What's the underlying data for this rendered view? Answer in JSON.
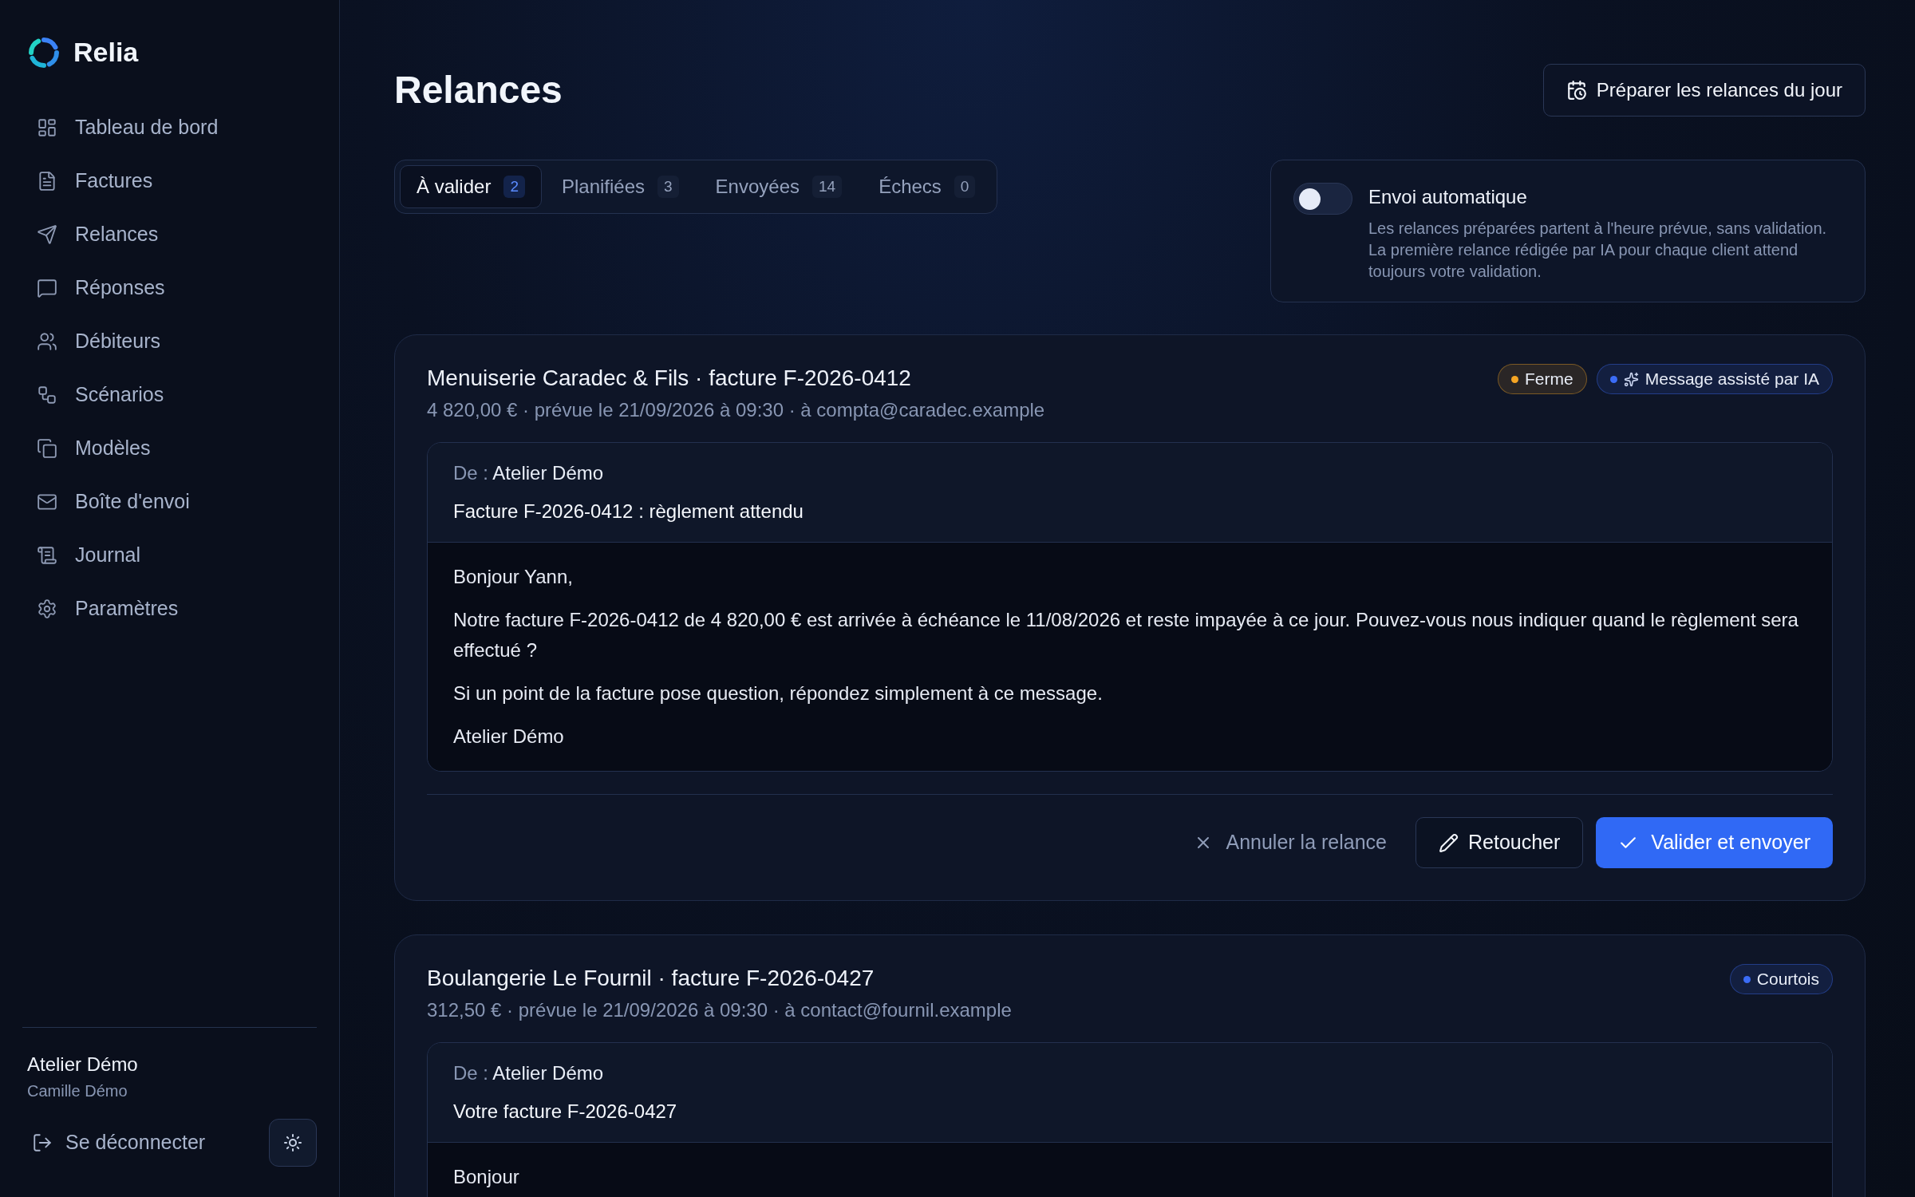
{
  "sidebar": {
    "brand": "Relia",
    "nav": [
      {
        "label": "Tableau de bord"
      },
      {
        "label": "Factures"
      },
      {
        "label": "Relances"
      },
      {
        "label": "Réponses"
      },
      {
        "label": "Débiteurs"
      },
      {
        "label": "Scénarios"
      },
      {
        "label": "Modèles"
      },
      {
        "label": "Boîte d'envoi"
      },
      {
        "label": "Journal"
      },
      {
        "label": "Paramètres"
      }
    ],
    "account": {
      "company": "Atelier Démo",
      "user": "Camille Démo"
    },
    "logout": "Se déconnecter"
  },
  "page": {
    "title": "Relances",
    "action": "Préparer les relances du jour"
  },
  "tabs": [
    {
      "label": "À valider",
      "count": "2",
      "selected": true
    },
    {
      "label": "Planifiées",
      "count": "3",
      "selected": false
    },
    {
      "label": "Envoyées",
      "count": "14",
      "selected": false
    },
    {
      "label": "Échecs",
      "count": "0",
      "selected": false
    }
  ],
  "auto_send": {
    "title": "Envoi automatique",
    "description": "Les relances préparées partent à l'heure prévue, sans validation. La première relance rédigée par IA pour chaque client attend toujours votre validation.",
    "on": false
  },
  "reminders": [
    {
      "title": "Menuiserie Caradec & Fils · facture F-2026-0412",
      "meta": "4 820,00 € · prévue le 21/09/2026 à 09:30 · à compta@caradec.example",
      "badges": [
        {
          "label": "Ferme",
          "color": "#f5a524",
          "kind": "tone"
        },
        {
          "label": "Message assisté par IA",
          "color": "#3b6cf6",
          "kind": "ai"
        }
      ],
      "from_label": "De :",
      "from": "Atelier Démo",
      "subject": "Facture F-2026-0412 : règlement attendu",
      "body": [
        "Bonjour Yann,",
        "Notre facture F-2026-0412 de 4 820,00 € est arrivée à échéance le 11/08/2026 et reste impayée à ce jour. Pouvez-vous nous indiquer quand le règlement sera effectué ?",
        "Si un point de la facture pose question, répondez simplement à ce message.",
        "Atelier Démo"
      ],
      "actions": {
        "cancel": "Annuler la relance",
        "edit": "Retoucher",
        "send": "Valider et envoyer"
      }
    },
    {
      "title": "Boulangerie Le Fournil · facture F-2026-0427",
      "meta": "312,50 € · prévue le 21/09/2026 à 09:30 · à contact@fournil.example",
      "badges": [
        {
          "label": "Courtois",
          "color": "#3b6cf6",
          "kind": "tone"
        }
      ],
      "from_label": "De :",
      "from": "Atelier Démo",
      "subject": "Votre facture F-2026-0427",
      "body": [
        "Bonjour"
      ]
    }
  ]
}
